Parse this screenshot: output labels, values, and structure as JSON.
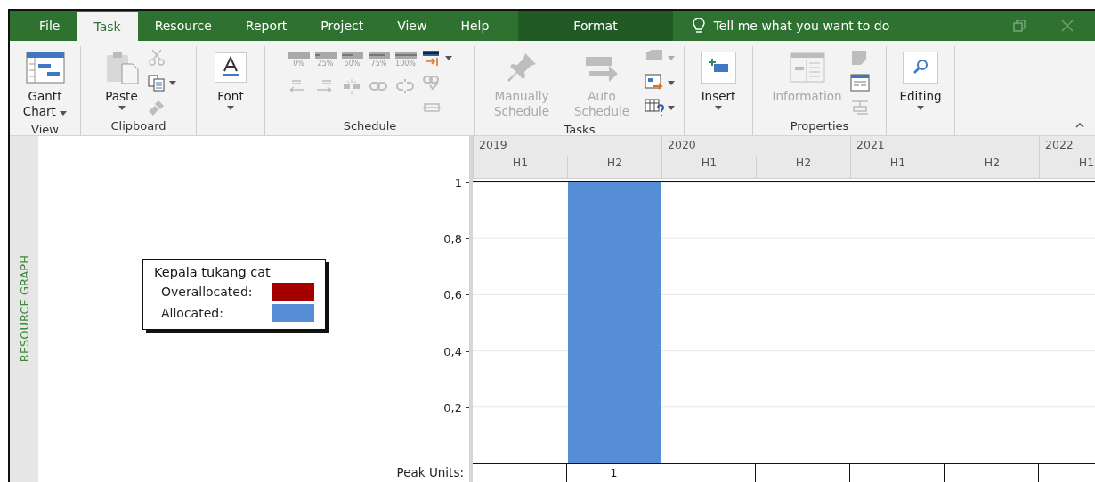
{
  "tabs": [
    {
      "label": "File",
      "selected": false,
      "contextual": false
    },
    {
      "label": "Task",
      "selected": true,
      "contextual": false
    },
    {
      "label": "Resource",
      "selected": false,
      "contextual": false
    },
    {
      "label": "Report",
      "selected": false,
      "contextual": false
    },
    {
      "label": "Project",
      "selected": false,
      "contextual": false
    },
    {
      "label": "View",
      "selected": false,
      "contextual": false
    },
    {
      "label": "Help",
      "selected": false,
      "contextual": false
    },
    {
      "label": "Format",
      "selected": false,
      "contextual": true
    }
  ],
  "tell_me": {
    "placeholder": "Tell me what you want to do"
  },
  "ribbon": {
    "groups": [
      {
        "label": "View",
        "commands": [
          {
            "kind": "large",
            "label": "Gantt Chart",
            "disabled": false,
            "dropdown": true
          }
        ]
      },
      {
        "label": "Clipboard",
        "commands": [
          {
            "kind": "large",
            "label": "Paste",
            "disabled": false,
            "dropdown": true
          },
          {
            "kind": "small",
            "disabled": true,
            "dropdown": false
          },
          {
            "kind": "small",
            "disabled": false,
            "dropdown": true
          },
          {
            "kind": "small",
            "disabled": true,
            "dropdown": false
          }
        ]
      },
      {
        "commands": [
          {
            "kind": "large",
            "label": "Font",
            "disabled": false,
            "dropdown": true
          }
        ]
      },
      {
        "label": "Schedule",
        "percent": [
          {
            "label": "0%",
            "disabled": true
          },
          {
            "label": "25%",
            "disabled": true
          },
          {
            "label": "50%",
            "disabled": true
          },
          {
            "label": "75%",
            "disabled": true
          },
          {
            "label": "100%",
            "disabled": true
          }
        ],
        "commands": [
          {
            "kind": "small",
            "disabled": false,
            "dropdown": true
          },
          {
            "kind": "small",
            "disabled": true,
            "dropdown": false
          },
          {
            "kind": "small",
            "disabled": true,
            "dropdown": false
          },
          {
            "kind": "small",
            "disabled": true,
            "dropdown": false
          },
          {
            "kind": "small",
            "disabled": true,
            "dropdown": false
          },
          {
            "kind": "small",
            "disabled": true,
            "dropdown": false
          },
          {
            "kind": "small",
            "disabled": true,
            "dropdown": false
          },
          {
            "kind": "small",
            "disabled": true,
            "dropdown": false
          }
        ]
      },
      {
        "label": "Tasks",
        "commands": [
          {
            "kind": "large",
            "label": "Manually Schedule",
            "disabled": true,
            "dropdown": false
          },
          {
            "kind": "large",
            "label": "Auto Schedule",
            "disabled": true,
            "dropdown": false
          },
          {
            "kind": "small",
            "disabled": true,
            "dropdown": true
          },
          {
            "kind": "small",
            "disabled": false,
            "dropdown": true
          },
          {
            "kind": "small",
            "disabled": false,
            "dropdown": true
          }
        ]
      },
      {
        "commands": [
          {
            "kind": "large",
            "label": "Insert",
            "disabled": false,
            "dropdown": true
          }
        ]
      },
      {
        "label": "Properties",
        "commands": [
          {
            "kind": "large",
            "label": "Information",
            "disabled": true,
            "dropdown": false
          },
          {
            "kind": "small",
            "disabled": true,
            "dropdown": false
          },
          {
            "kind": "small",
            "disabled": false,
            "dropdown": false
          },
          {
            "kind": "small",
            "disabled": true,
            "dropdown": false
          }
        ]
      },
      {
        "commands": [
          {
            "kind": "large",
            "label": "Editing",
            "disabled": false,
            "dropdown": true
          }
        ]
      }
    ]
  },
  "side_label": "RESOURCE GRAPH",
  "legend": {
    "title": "Kepala tukang cat",
    "items": [
      {
        "label": "Overallocated:",
        "color": "#a50000"
      },
      {
        "label": "Allocated:",
        "color": "#558ed5"
      }
    ]
  },
  "timescale": {
    "years": [
      "2019",
      "2020",
      "2021",
      "2022"
    ],
    "halves": [
      "H1",
      "H2",
      "H1",
      "H2",
      "H1",
      "H2",
      "H1"
    ]
  },
  "chart": {
    "chart_data": {
      "type": "bar",
      "series": [
        {
          "color": "#558ed5",
          "values": [
            0,
            1,
            0,
            0,
            0,
            0,
            0
          ]
        }
      ],
      "ylim": [
        0,
        1
      ],
      "grid": true,
      "yticks": [
        {
          "value": 0.2,
          "label": "0,2"
        },
        {
          "value": 0.4,
          "label": "0,4"
        },
        {
          "value": 0.6,
          "label": "0,6"
        },
        {
          "value": 0.8,
          "label": "0,8"
        },
        {
          "value": 1,
          "label": "1"
        }
      ]
    }
  },
  "peak_units": {
    "label": "Peak Units:",
    "cells": [
      null,
      "1",
      null,
      null,
      null,
      null,
      null
    ]
  }
}
